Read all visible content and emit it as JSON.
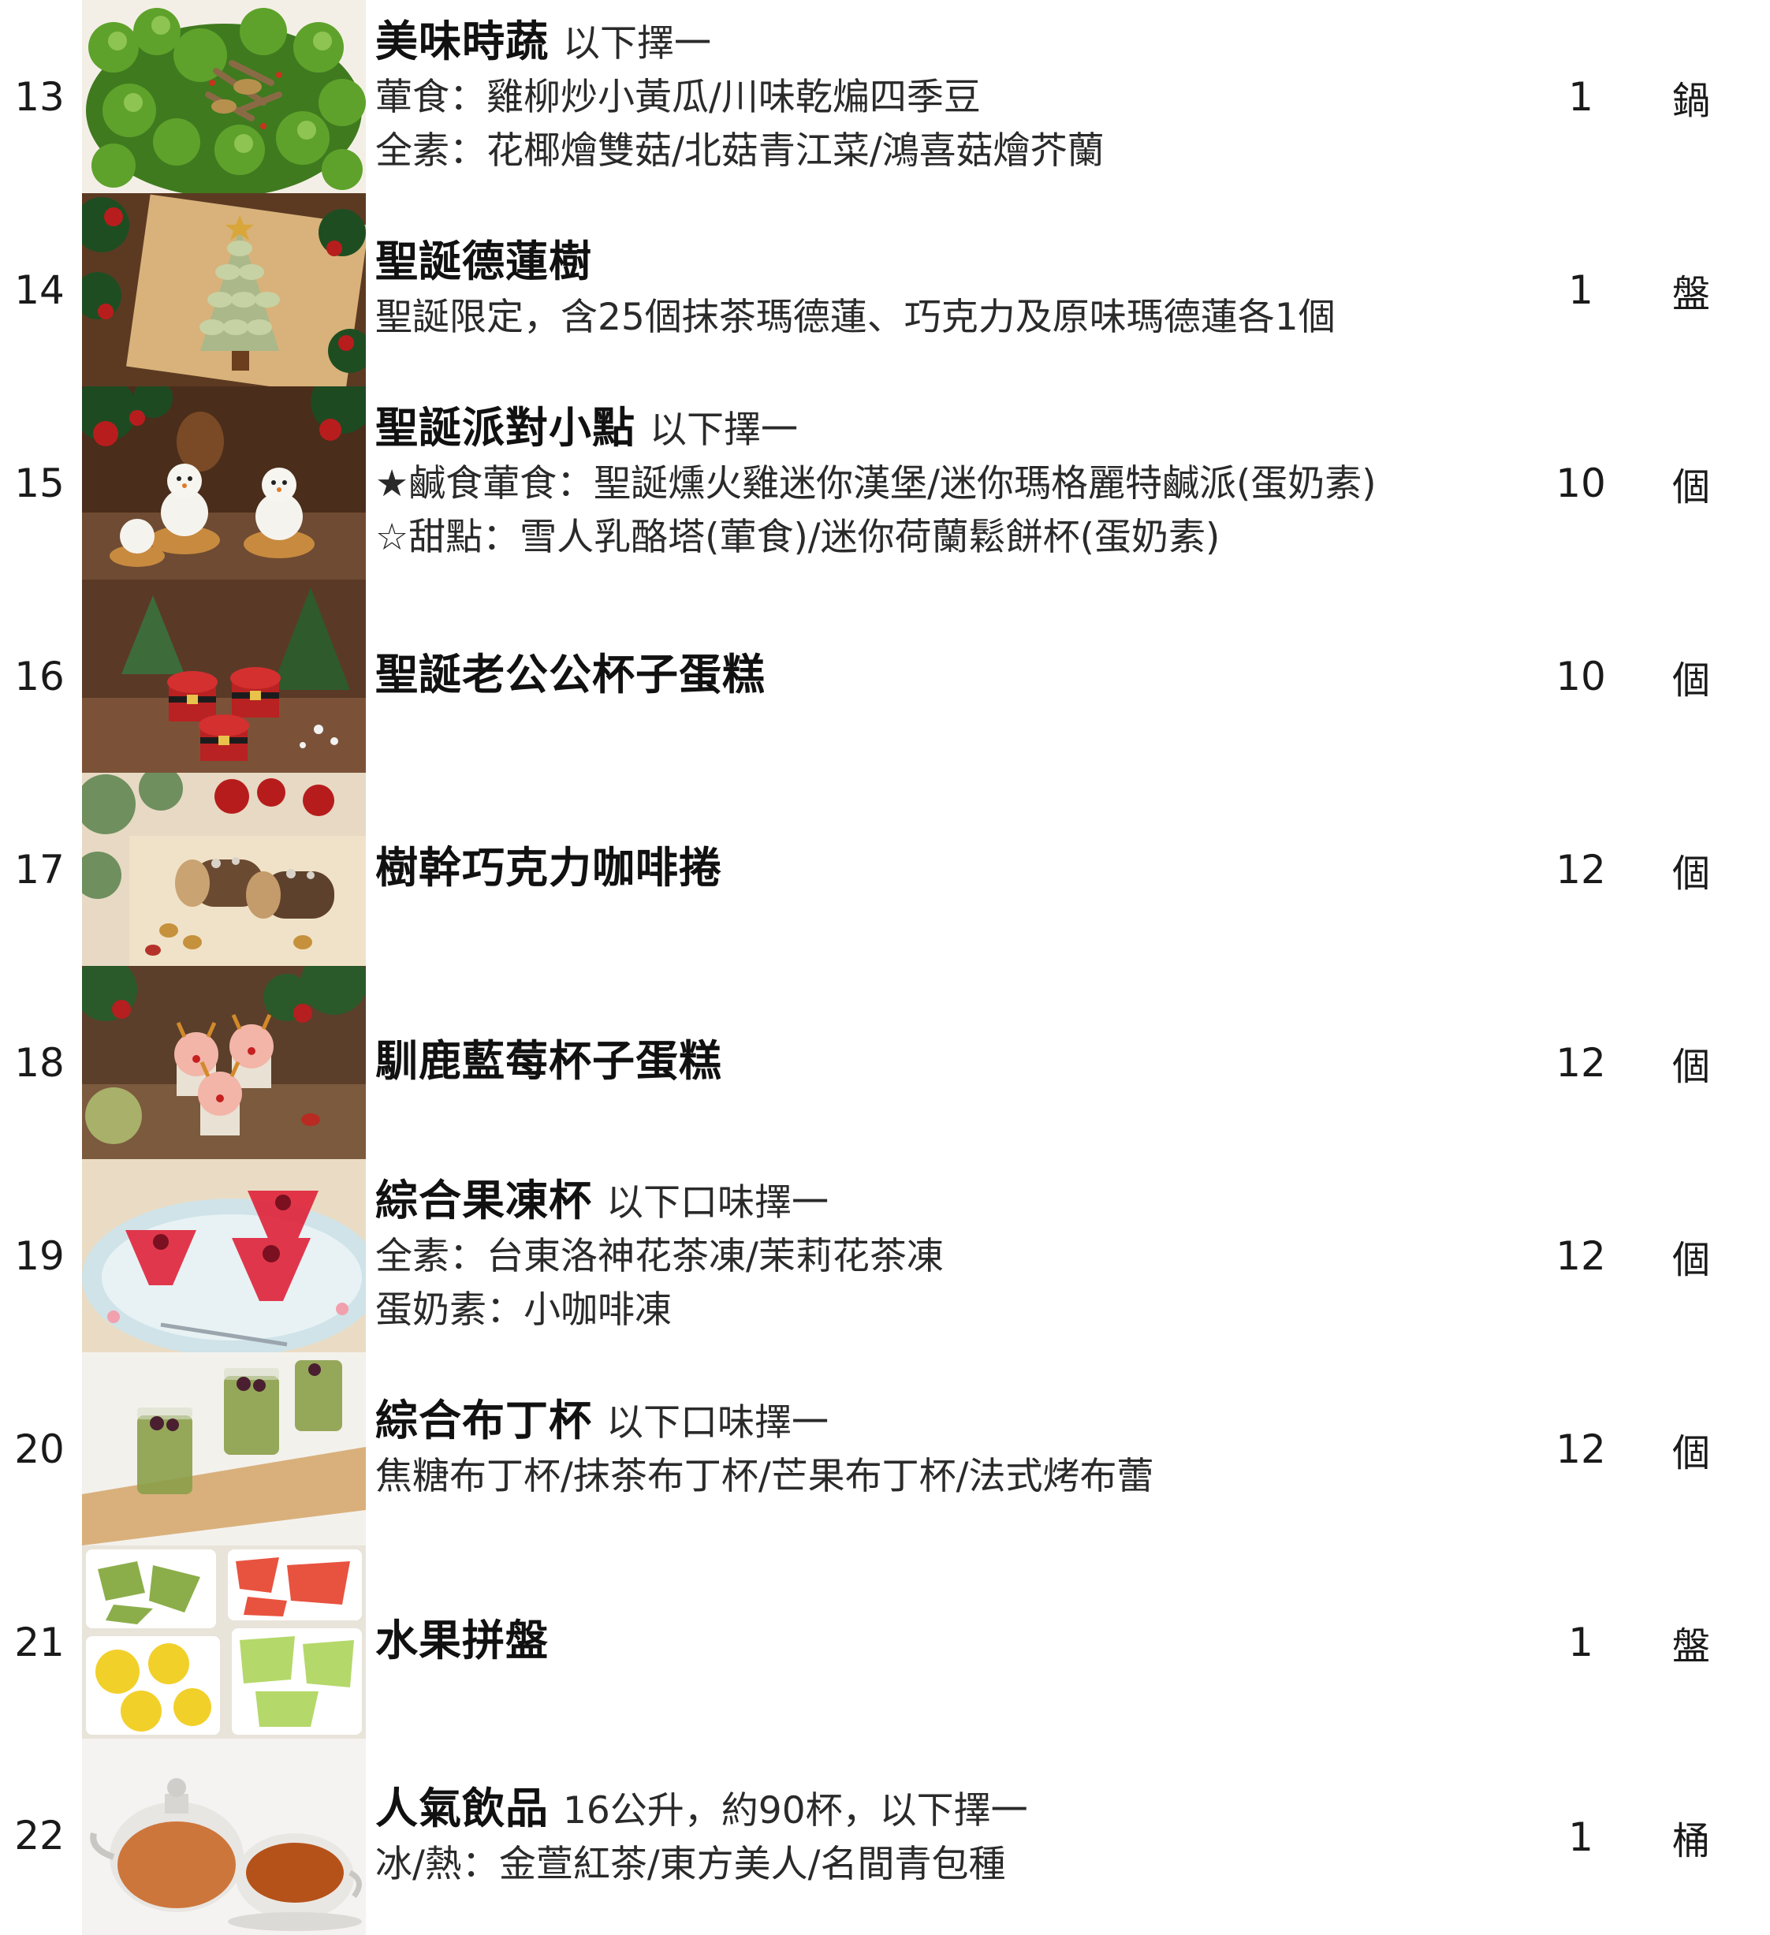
{
  "items": [
    {
      "num": "13",
      "title": "美味時蔬",
      "subtitle": "以下擇一",
      "lines": [
        "葷食：雞柳炒小黃瓜/川味乾煸四季豆",
        "全素：花椰燴雙菇/北菇青江菜/鴻喜菇燴芥蘭"
      ],
      "qty": "1",
      "unit": "鍋",
      "photo": "vegetables-photo"
    },
    {
      "num": "14",
      "title": "聖誕德蓮樹",
      "subtitle": "",
      "lines": [
        "聖誕限定，含25個抹茶瑪德蓮、巧克力及原味瑪德蓮各1個"
      ],
      "qty": "1",
      "unit": "盤",
      "photo": "madeleine-tree-photo"
    },
    {
      "num": "15",
      "title": "聖誕派對小點",
      "subtitle": "以下擇一",
      "lines": [
        "★鹹食葷食：聖誕燻火雞迷你漢堡/迷你瑪格麗特鹹派(蛋奶素)",
        "☆甜點：雪人乳酪塔(葷食)/迷你荷蘭鬆餅杯(蛋奶素)"
      ],
      "qty": "10",
      "unit": "個",
      "photo": "snowman-tart-photo"
    },
    {
      "num": "16",
      "title": "聖誕老公公杯子蛋糕",
      "subtitle": "",
      "lines": [],
      "qty": "10",
      "unit": "個",
      "photo": "santa-cupcake-photo"
    },
    {
      "num": "17",
      "title": "樹幹巧克力咖啡捲",
      "subtitle": "",
      "lines": [],
      "qty": "12",
      "unit": "個",
      "photo": "log-roll-photo"
    },
    {
      "num": "18",
      "title": "馴鹿藍莓杯子蛋糕",
      "subtitle": "",
      "lines": [],
      "qty": "12",
      "unit": "個",
      "photo": "reindeer-cupcake-photo"
    },
    {
      "num": "19",
      "title": "綜合果凍杯",
      "subtitle": "以下口味擇一",
      "lines": [
        "全素：台東洛神花茶凍/茉莉花茶凍",
        "蛋奶素：小咖啡凍"
      ],
      "qty": "12",
      "unit": "個",
      "photo": "jelly-cup-photo"
    },
    {
      "num": "20",
      "title": "綜合布丁杯",
      "subtitle": "以下口味擇一",
      "lines": [
        "焦糖布丁杯/抹茶布丁杯/芒果布丁杯/法式烤布蕾"
      ],
      "qty": "12",
      "unit": "個",
      "photo": "pudding-cup-photo"
    },
    {
      "num": "21",
      "title": "水果拼盤",
      "subtitle": "",
      "lines": [],
      "qty": "1",
      "unit": "盤",
      "photo": "fruit-platter-photo"
    },
    {
      "num": "22",
      "title": "人氣飲品",
      "subtitle": "16公升，約90杯，以下擇一",
      "lines": [
        "冰/熱：金萱紅茶/東方美人/名間青包種"
      ],
      "qty": "1",
      "unit": "桶",
      "photo": "tea-photo"
    }
  ]
}
